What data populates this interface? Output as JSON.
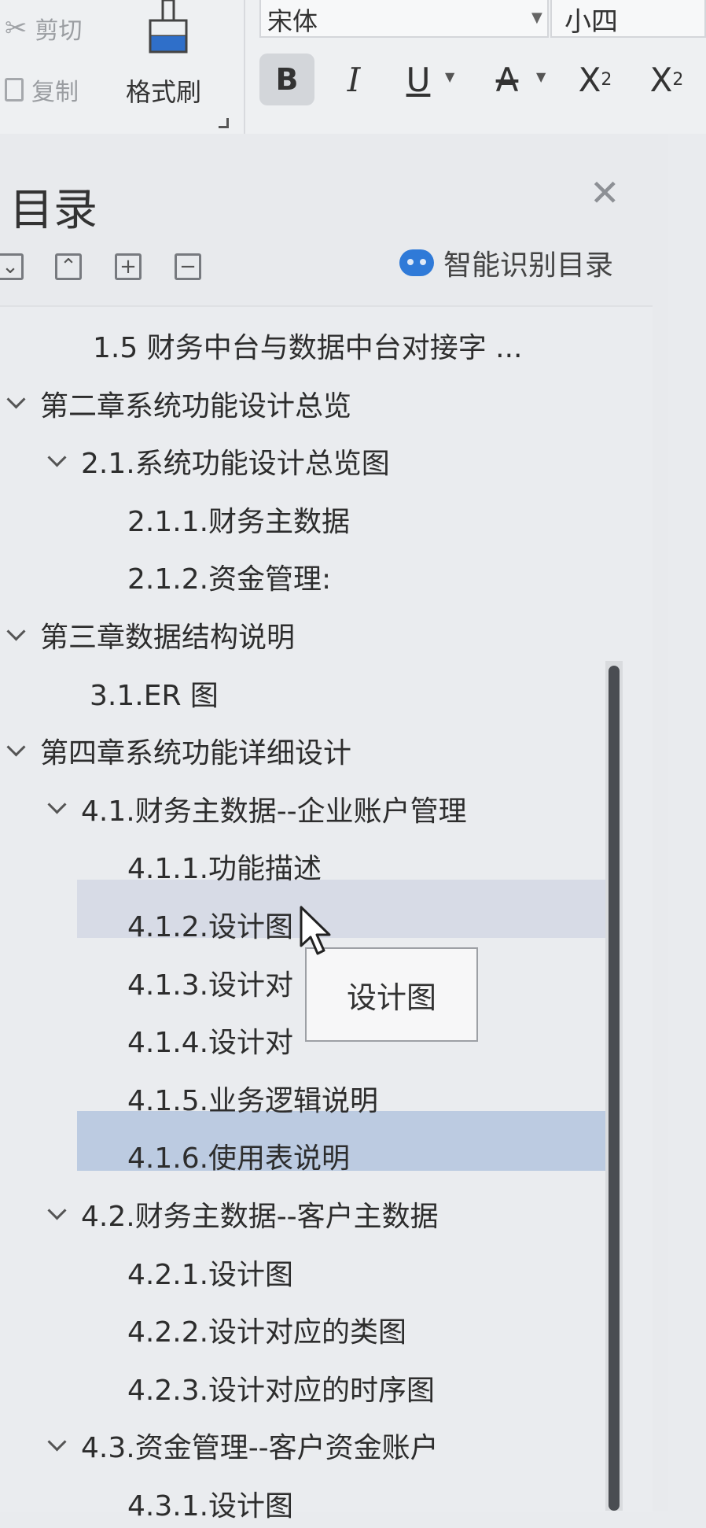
{
  "toolbar": {
    "cut_label": "剪切",
    "copy_label": "复制",
    "format_painter_label": "格式刷",
    "font_name": "宋体",
    "font_size": "小四",
    "bold": "B",
    "italic": "I",
    "underline": "U",
    "strike": "A",
    "superscript": "X",
    "superscript_mark": "2",
    "subscript": "X",
    "subscript_mark": "2"
  },
  "panel": {
    "title": "目录",
    "smart_label": "智能识别目录"
  },
  "toc": [
    {
      "label": "1.5  财务中台与数据中台对接字 ...",
      "level": 2,
      "expanded": false
    },
    {
      "label": "第二章系统功能设计总览",
      "level": 0,
      "expanded": true
    },
    {
      "label": "2.1.系统功能设计总览图",
      "level": 1,
      "expanded": true
    },
    {
      "label": "2.1.1.财务主数据",
      "level": 2,
      "expanded": false
    },
    {
      "label": "2.1.2.资金管理:",
      "level": 2,
      "expanded": false
    },
    {
      "label": "第三章数据结构说明",
      "level": 0,
      "expanded": true
    },
    {
      "label": "3.1.ER 图",
      "level": 1,
      "expanded": false
    },
    {
      "label": "第四章系统功能详细设计",
      "level": 0,
      "expanded": true
    },
    {
      "label": "4.1.财务主数据--企业账户管理",
      "level": 1,
      "expanded": true
    },
    {
      "label": "4.1.1.功能描述",
      "level": 2,
      "expanded": false
    },
    {
      "label": "4.1.2.设计图",
      "level": 2,
      "expanded": false
    },
    {
      "label": "4.1.3.设计对",
      "level": 2,
      "expanded": false
    },
    {
      "label": "4.1.4.设计对",
      "level": 2,
      "expanded": false
    },
    {
      "label": "4.1.5.业务逻辑说明",
      "level": 2,
      "expanded": false
    },
    {
      "label": "4.1.6.使用表说明",
      "level": 2,
      "expanded": false
    },
    {
      "label": "4.2.财务主数据--客户主数据",
      "level": 1,
      "expanded": true
    },
    {
      "label": "4.2.1.设计图",
      "level": 2,
      "expanded": false
    },
    {
      "label": "4.2.2.设计对应的类图",
      "level": 2,
      "expanded": false
    },
    {
      "label": "4.2.3.设计对应的时序图",
      "level": 2,
      "expanded": false
    },
    {
      "label": "4.3.资金管理--客户资金账户",
      "level": 1,
      "expanded": true
    },
    {
      "label": "4.3.1.设计图",
      "level": 2,
      "expanded": false
    }
  ],
  "tooltip": "设计图"
}
